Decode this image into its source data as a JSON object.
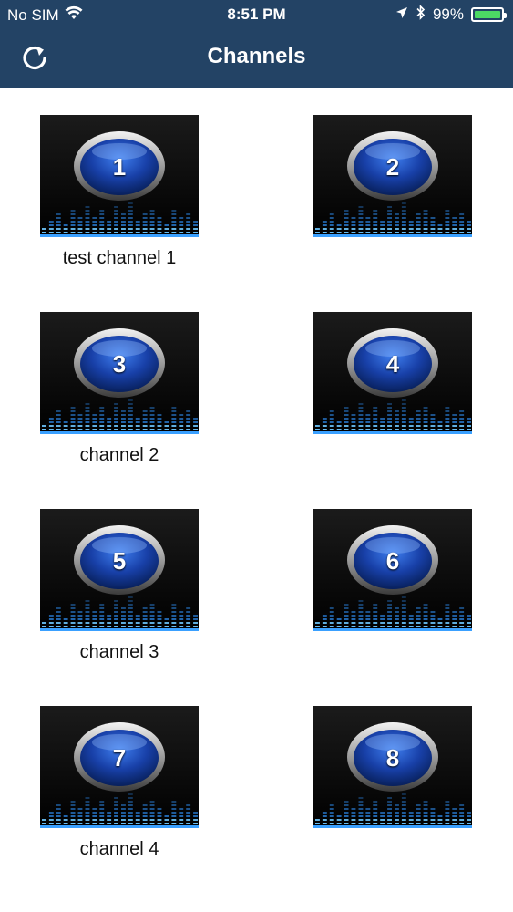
{
  "status_bar": {
    "carrier": "No SIM",
    "time": "8:51 PM",
    "battery_percent": "99%",
    "battery_level": 0.99,
    "icons": [
      "wifi-icon",
      "location-arrow-icon",
      "bluetooth-icon",
      "battery-icon"
    ]
  },
  "nav": {
    "title": "Channels",
    "refresh_icon": "refresh-icon"
  },
  "colors": {
    "header_bg": "#234365",
    "accent_blue": "#3aa0ff",
    "battery_green": "#4cd964"
  },
  "channels": [
    {
      "number": "1",
      "label": "test channel 1"
    },
    {
      "number": "2",
      "label": ""
    },
    {
      "number": "3",
      "label": "channel 2"
    },
    {
      "number": "4",
      "label": ""
    },
    {
      "number": "5",
      "label": "channel 3"
    },
    {
      "number": "6",
      "label": ""
    },
    {
      "number": "7",
      "label": "channel 4"
    },
    {
      "number": "8",
      "label": ""
    }
  ]
}
